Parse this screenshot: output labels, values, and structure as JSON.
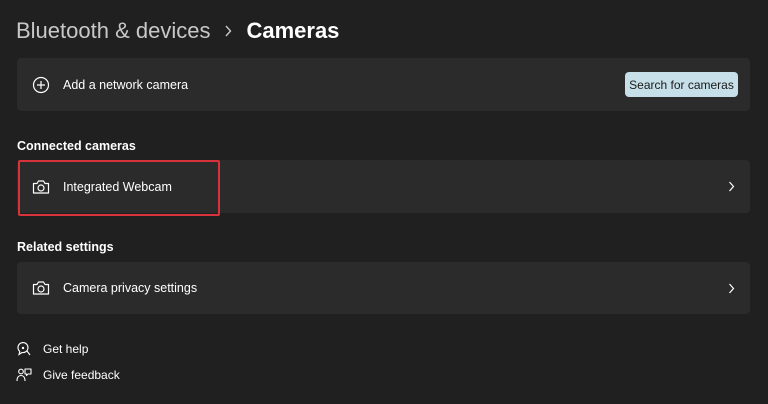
{
  "breadcrumb": {
    "parent": "Bluetooth & devices",
    "current": "Cameras"
  },
  "network_camera": {
    "label": "Add a network camera",
    "icon": "plus-circle-icon",
    "button_label": "Search for cameras"
  },
  "connected": {
    "heading": "Connected cameras",
    "items": [
      {
        "label": "Integrated Webcam",
        "icon": "camera-icon",
        "highlighted": true
      }
    ]
  },
  "related": {
    "heading": "Related settings",
    "items": [
      {
        "label": "Camera privacy settings",
        "icon": "camera-icon"
      }
    ]
  },
  "footer": {
    "help": "Get help",
    "feedback": "Give feedback"
  },
  "colors": {
    "background": "#202020",
    "card": "#2b2b2b",
    "accent_button": "#c7dfe9",
    "highlight_border": "#d8333a"
  }
}
